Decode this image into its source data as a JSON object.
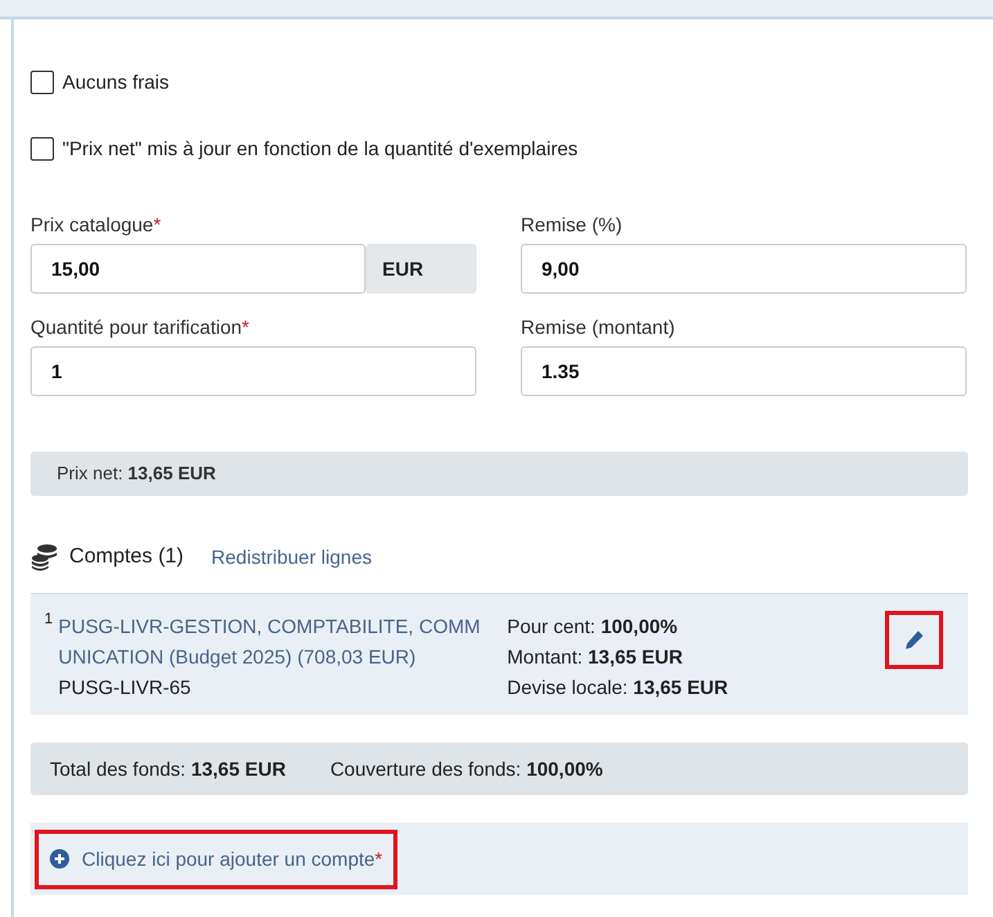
{
  "checkboxes": [
    {
      "label": "Aucuns frais",
      "checked": false
    },
    {
      "label": "\"Prix net\" mis à jour en fonction de la quantité d'exemplaires",
      "checked": false
    }
  ],
  "fields": [
    {
      "label": "Prix catalogue",
      "required_mark": "*",
      "value": "15,00",
      "suffix": "EUR"
    },
    {
      "label": "Remise (%)",
      "value": "9,00"
    },
    {
      "label": "Quantité pour tarification",
      "required_mark": "*",
      "value": "1"
    },
    {
      "label": "Remise (montant)",
      "value": "1.35"
    }
  ],
  "net_price": "Prix net: **13,65 EUR**",
  "accounts": {
    "title": "Comptes (1)",
    "redistribute_link": "Redistribuer lignes",
    "items": [
      {
        "index": "1",
        "name": "PUSG-LIVR-GESTION, COMPTABILITE, COMMUNICATION (Budget 2025) (708,03 EUR)",
        "code": "PUSG-LIVR-65",
        "details": [
          "Pour cent: **100,00%**",
          "Montant: **13,65 EUR**",
          "Devise locale: **13,65 EUR**"
        ],
        "edit_highlighted": true
      }
    ]
  },
  "totals": [
    "Total des fonds: **13,65 EUR**",
    "Couverture des fonds: **100,00%**"
  ],
  "add_account": {
    "label": "Cliquez ici pour ajouter un compte",
    "required_mark": "*",
    "highlighted": true
  }
}
